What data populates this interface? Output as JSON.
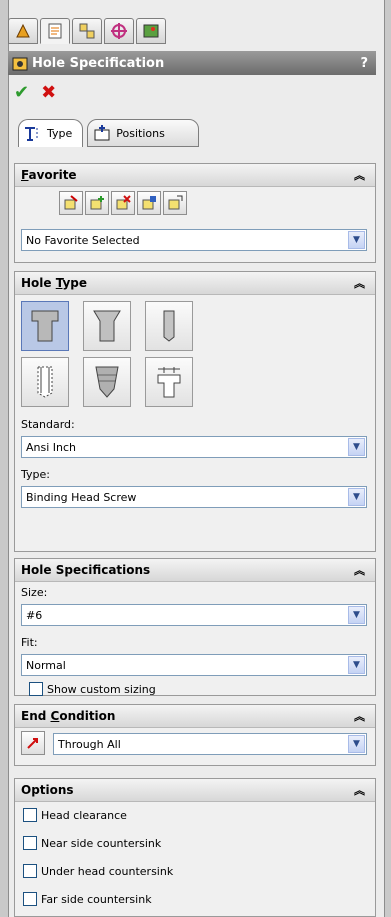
{
  "title": {
    "text": "Hole Specification",
    "help": "?"
  },
  "actions": {
    "ok": "✔",
    "cancel": "✖"
  },
  "top_tabs": [
    "feature-manager",
    "property-manager",
    "configuration-manager",
    "dim-xpert",
    "display-manager"
  ],
  "feature_tabs": {
    "type": "Type",
    "positions": "Positions"
  },
  "favorite": {
    "header": "Favorite",
    "header_mnemonic": "F",
    "selected": "No Favorite Selected"
  },
  "hole_type": {
    "header": "Hole Type",
    "header_mnemonic": "T",
    "standard_label": "Standard:",
    "standard_value": "Ansi Inch",
    "type_label": "Type:",
    "type_value": "Binding Head Screw"
  },
  "hole_specs": {
    "header": "Hole Specifications",
    "size_label": "Size:",
    "size_value": "#6",
    "fit_label": "Fit:",
    "fit_value": "Normal",
    "custom_label": "Show custom sizing"
  },
  "end_condition": {
    "header": "End Condition",
    "header_mnemonic": "C",
    "value": "Through All"
  },
  "options": {
    "header": "Options",
    "items": [
      "Head clearance",
      "Near side countersink",
      "Under head countersink",
      "Far side countersink"
    ]
  },
  "colors": {
    "titlebar": "#7f7f7f",
    "ok": "#2e9b2e",
    "cancel": "#d01010",
    "selected_button": "#b9c8e6"
  }
}
